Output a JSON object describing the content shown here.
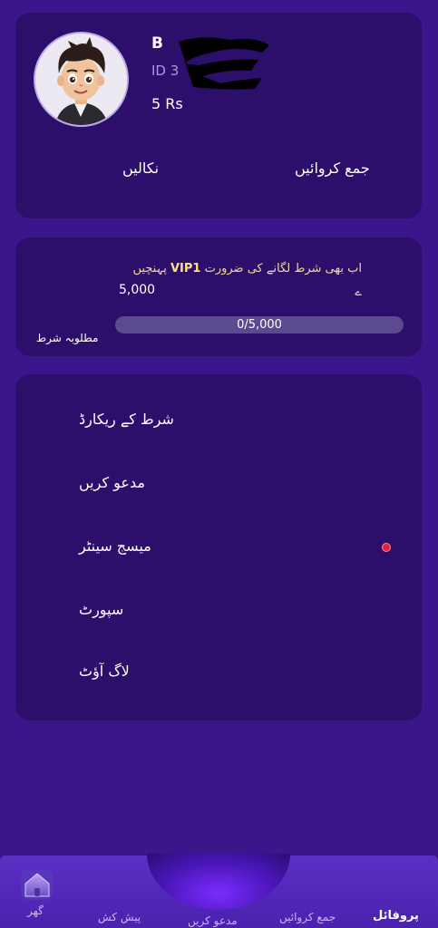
{
  "profile": {
    "username": "B",
    "user_id": "ID  3",
    "balance": "5 Rs",
    "withdraw_label": "نکالیں",
    "deposit_label": "جمع کروائیں"
  },
  "vip": {
    "message_part1": "اب بھی شرط لگانے کی ضرورت",
    "level": "VIP1",
    "message_part2": "پہنچیں",
    "message_part3": "ے",
    "amount": "5,000",
    "progress_text": "0/5,000",
    "progress_fraction": 0,
    "required_label": "مطلوبہ شرط"
  },
  "menu": {
    "items": [
      {
        "label": "شرط کے ریکارڈ"
      },
      {
        "label": "مدعو کریں"
      },
      {
        "label": "میسج سینٹر",
        "has_notification": true
      },
      {
        "label": "سپورٹ"
      },
      {
        "label": "لاگ آؤٹ"
      }
    ]
  },
  "nav": {
    "home": "گھر",
    "offers": "پیش کش",
    "invite": "مدعو کریں",
    "deposit": "جمع کروائیں",
    "profile": "پروفائل",
    "active": "profile"
  },
  "colors": {
    "background": "#3a168a",
    "card": "#2c0f6b",
    "accent_gold": "#f3d7a0",
    "notification": "#e8203a"
  }
}
